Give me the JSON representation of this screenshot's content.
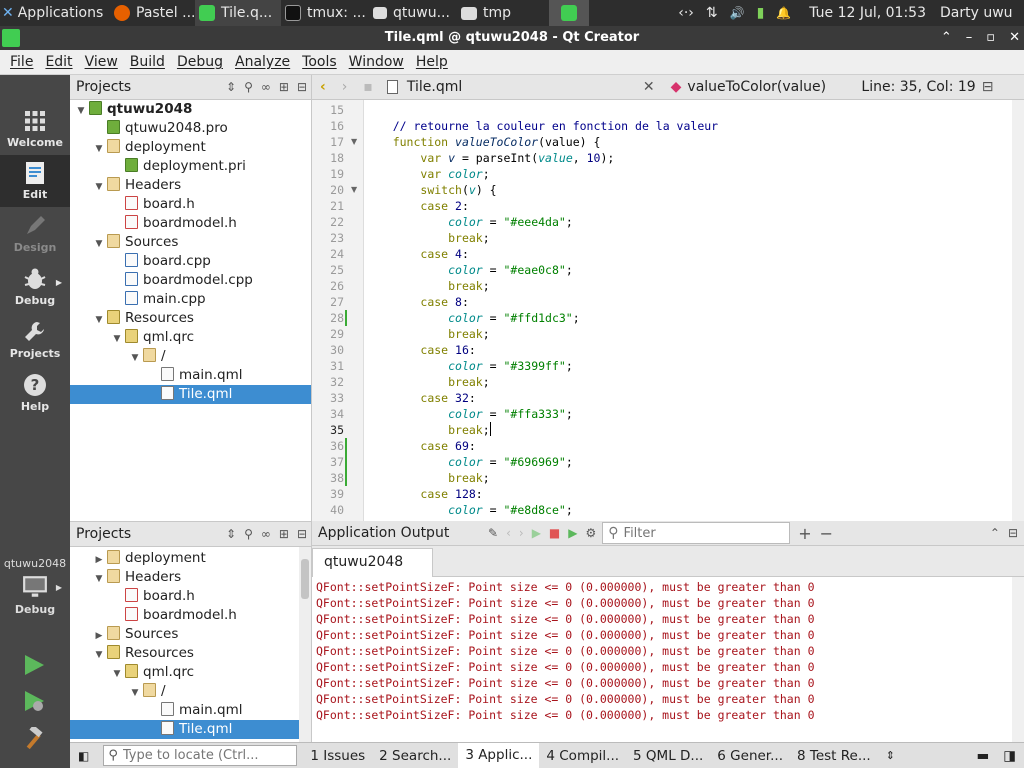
{
  "taskbar": {
    "applications": "Applications",
    "menu_glyph": "⋮",
    "items": [
      "Pastel ...",
      "Tile.q...",
      "tmux: ...",
      "qtuwu...",
      "tmp"
    ],
    "tray_glyphs": [
      "‹·›",
      "⇅",
      "🔊",
      "▮",
      "🔔"
    ],
    "clock": "Tue 12 Jul, 01:53",
    "user": "Darty uwu"
  },
  "window": {
    "title": "Tile.qml @ qtuwu2048 - Qt Creator",
    "controls": [
      "⌃",
      "–",
      "▫",
      "✕"
    ]
  },
  "menubar": [
    "File",
    "Edit",
    "View",
    "Build",
    "Debug",
    "Analyze",
    "Tools",
    "Window",
    "Help"
  ],
  "modes": [
    {
      "label": "Welcome"
    },
    {
      "label": "Edit"
    },
    {
      "label": "Design"
    },
    {
      "label": "Debug"
    },
    {
      "label": "Projects"
    },
    {
      "label": "Help"
    }
  ],
  "kit": {
    "project": "qtuwu2048",
    "mode": "Debug"
  },
  "projects_top": {
    "title": "Projects",
    "tree": [
      {
        "label": "qtuwu2048",
        "depth": 0,
        "arrow": "▼",
        "icon": "pro",
        "bold": true
      },
      {
        "label": "qtuwu2048.pro",
        "depth": 1,
        "arrow": "",
        "icon": "pro"
      },
      {
        "label": "deployment",
        "depth": 1,
        "arrow": "▼",
        "icon": "folder"
      },
      {
        "label": "deployment.pri",
        "depth": 2,
        "arrow": "",
        "icon": "pro"
      },
      {
        "label": "Headers",
        "depth": 1,
        "arrow": "▼",
        "icon": "folder"
      },
      {
        "label": "board.h",
        "depth": 2,
        "arrow": "",
        "icon": "h"
      },
      {
        "label": "boardmodel.h",
        "depth": 2,
        "arrow": "",
        "icon": "h"
      },
      {
        "label": "Sources",
        "depth": 1,
        "arrow": "▼",
        "icon": "folder"
      },
      {
        "label": "board.cpp",
        "depth": 2,
        "arrow": "",
        "icon": "cpp"
      },
      {
        "label": "boardmodel.cpp",
        "depth": 2,
        "arrow": "",
        "icon": "cpp"
      },
      {
        "label": "main.cpp",
        "depth": 2,
        "arrow": "",
        "icon": "cpp"
      },
      {
        "label": "Resources",
        "depth": 1,
        "arrow": "▼",
        "icon": "res"
      },
      {
        "label": "qml.qrc",
        "depth": 2,
        "arrow": "▼",
        "icon": "res"
      },
      {
        "label": "/",
        "depth": 3,
        "arrow": "▼",
        "icon": "folder"
      },
      {
        "label": "main.qml",
        "depth": 4,
        "arrow": "",
        "icon": "qml"
      },
      {
        "label": "Tile.qml",
        "depth": 4,
        "arrow": "",
        "icon": "qml",
        "selected": true
      }
    ]
  },
  "projects_bottom": {
    "title": "Projects",
    "tree": [
      {
        "label": "deployment",
        "depth": 1,
        "arrow": "▶",
        "icon": "folder"
      },
      {
        "label": "Headers",
        "depth": 1,
        "arrow": "▼",
        "icon": "folder"
      },
      {
        "label": "board.h",
        "depth": 2,
        "arrow": "",
        "icon": "h"
      },
      {
        "label": "boardmodel.h",
        "depth": 2,
        "arrow": "",
        "icon": "h"
      },
      {
        "label": "Sources",
        "depth": 1,
        "arrow": "▶",
        "icon": "folder"
      },
      {
        "label": "Resources",
        "depth": 1,
        "arrow": "▼",
        "icon": "res"
      },
      {
        "label": "qml.qrc",
        "depth": 2,
        "arrow": "▼",
        "icon": "res"
      },
      {
        "label": "/",
        "depth": 3,
        "arrow": "▼",
        "icon": "folder"
      },
      {
        "label": "main.qml",
        "depth": 4,
        "arrow": "",
        "icon": "qml"
      },
      {
        "label": "Tile.qml",
        "depth": 4,
        "arrow": "",
        "icon": "qml",
        "selected": true
      }
    ]
  },
  "editor": {
    "file": "Tile.qml",
    "symbol": "valueToColor(value)",
    "position": "Line: 35, Col: 19",
    "current_line": 35,
    "lines": [
      {
        "n": 15,
        "seg": [],
        "fold": false,
        "chg": false
      },
      {
        "n": 16,
        "seg": [
          [
            "    // retourne la couleur en fonction de la valeur",
            "cm"
          ]
        ],
        "fold": false,
        "chg": false
      },
      {
        "n": 17,
        "seg": [
          [
            "    function ",
            "kw"
          ],
          [
            "valueToColor",
            "it"
          ],
          [
            "(value) {",
            ""
          ]
        ],
        "fold": true,
        "chg": false
      },
      {
        "n": 18,
        "seg": [
          [
            "        ",
            ""
          ],
          [
            "var ",
            "kw"
          ],
          [
            "v",
            "it"
          ],
          [
            " = parseInt(",
            ""
          ],
          [
            "value",
            "vr"
          ],
          [
            ", ",
            ""
          ],
          [
            "10",
            "num"
          ],
          [
            ");",
            ""
          ]
        ],
        "fold": false,
        "chg": false
      },
      {
        "n": 19,
        "seg": [
          [
            "        ",
            ""
          ],
          [
            "var ",
            "kw"
          ],
          [
            "color",
            "vr"
          ],
          [
            ";",
            ""
          ]
        ],
        "fold": false,
        "chg": false
      },
      {
        "n": 20,
        "seg": [
          [
            "        ",
            ""
          ],
          [
            "switch",
            "kw"
          ],
          [
            "(",
            ""
          ],
          [
            "v",
            "vr"
          ],
          [
            ") {",
            ""
          ]
        ],
        "fold": true,
        "chg": false
      },
      {
        "n": 21,
        "seg": [
          [
            "        ",
            ""
          ],
          [
            "case ",
            "kw"
          ],
          [
            "2",
            "num"
          ],
          [
            ":",
            ""
          ]
        ],
        "fold": false,
        "chg": false
      },
      {
        "n": 22,
        "seg": [
          [
            "            ",
            ""
          ],
          [
            "color",
            "vr"
          ],
          [
            " = ",
            ""
          ],
          [
            "\"#eee4da\"",
            "str"
          ],
          [
            ";",
            ""
          ]
        ],
        "fold": false,
        "chg": false
      },
      {
        "n": 23,
        "seg": [
          [
            "            ",
            ""
          ],
          [
            "break",
            "kw"
          ],
          [
            ";",
            ""
          ]
        ],
        "fold": false,
        "chg": false
      },
      {
        "n": 24,
        "seg": [
          [
            "        ",
            ""
          ],
          [
            "case ",
            "kw"
          ],
          [
            "4",
            "num"
          ],
          [
            ":",
            ""
          ]
        ],
        "fold": false,
        "chg": false
      },
      {
        "n": 25,
        "seg": [
          [
            "            ",
            ""
          ],
          [
            "color",
            "vr"
          ],
          [
            " = ",
            ""
          ],
          [
            "\"#eae0c8\"",
            "str"
          ],
          [
            ";",
            ""
          ]
        ],
        "fold": false,
        "chg": false
      },
      {
        "n": 26,
        "seg": [
          [
            "            ",
            ""
          ],
          [
            "break",
            "kw"
          ],
          [
            ";",
            ""
          ]
        ],
        "fold": false,
        "chg": false
      },
      {
        "n": 27,
        "seg": [
          [
            "        ",
            ""
          ],
          [
            "case ",
            "kw"
          ],
          [
            "8",
            "num"
          ],
          [
            ":",
            ""
          ]
        ],
        "fold": false,
        "chg": false
      },
      {
        "n": 28,
        "seg": [
          [
            "            ",
            ""
          ],
          [
            "color",
            "vr"
          ],
          [
            " = ",
            ""
          ],
          [
            "\"#ffd1dc3\"",
            "str"
          ],
          [
            ";",
            ""
          ]
        ],
        "fold": false,
        "chg": true
      },
      {
        "n": 29,
        "seg": [
          [
            "            ",
            ""
          ],
          [
            "break",
            "kw"
          ],
          [
            ";",
            ""
          ]
        ],
        "fold": false,
        "chg": false
      },
      {
        "n": 30,
        "seg": [
          [
            "        ",
            ""
          ],
          [
            "case ",
            "kw"
          ],
          [
            "16",
            "num"
          ],
          [
            ":",
            ""
          ]
        ],
        "fold": false,
        "chg": false
      },
      {
        "n": 31,
        "seg": [
          [
            "            ",
            ""
          ],
          [
            "color",
            "vr"
          ],
          [
            " = ",
            ""
          ],
          [
            "\"#3399ff\"",
            "str"
          ],
          [
            ";",
            ""
          ]
        ],
        "fold": false,
        "chg": false
      },
      {
        "n": 32,
        "seg": [
          [
            "            ",
            ""
          ],
          [
            "break",
            "kw"
          ],
          [
            ";",
            ""
          ]
        ],
        "fold": false,
        "chg": false
      },
      {
        "n": 33,
        "seg": [
          [
            "        ",
            ""
          ],
          [
            "case ",
            "kw"
          ],
          [
            "32",
            "num"
          ],
          [
            ":",
            ""
          ]
        ],
        "fold": false,
        "chg": false
      },
      {
        "n": 34,
        "seg": [
          [
            "            ",
            ""
          ],
          [
            "color",
            "vr"
          ],
          [
            " = ",
            ""
          ],
          [
            "\"#ffa333\"",
            "str"
          ],
          [
            ";",
            ""
          ]
        ],
        "fold": false,
        "chg": false
      },
      {
        "n": 35,
        "seg": [
          [
            "            ",
            ""
          ],
          [
            "break",
            "kw"
          ],
          [
            ";",
            ""
          ]
        ],
        "fold": false,
        "chg": false
      },
      {
        "n": 36,
        "seg": [
          [
            "        ",
            ""
          ],
          [
            "case ",
            "kw"
          ],
          [
            "69",
            "num"
          ],
          [
            ":",
            ""
          ]
        ],
        "fold": false,
        "chg": true
      },
      {
        "n": 37,
        "seg": [
          [
            "            ",
            ""
          ],
          [
            "color",
            "vr"
          ],
          [
            " = ",
            ""
          ],
          [
            "\"#696969\"",
            "str"
          ],
          [
            ";",
            ""
          ]
        ],
        "fold": false,
        "chg": true
      },
      {
        "n": 38,
        "seg": [
          [
            "            ",
            ""
          ],
          [
            "break",
            "kw"
          ],
          [
            ";",
            ""
          ]
        ],
        "fold": false,
        "chg": true
      },
      {
        "n": 39,
        "seg": [
          [
            "        ",
            ""
          ],
          [
            "case ",
            "kw"
          ],
          [
            "128",
            "num"
          ],
          [
            ":",
            ""
          ]
        ],
        "fold": false,
        "chg": false
      },
      {
        "n": 40,
        "seg": [
          [
            "            ",
            ""
          ],
          [
            "color",
            "vr"
          ],
          [
            " = ",
            ""
          ],
          [
            "\"#e8d8ce\"",
            "str"
          ],
          [
            ";",
            ""
          ]
        ],
        "fold": false,
        "chg": false
      }
    ]
  },
  "output": {
    "title": "Application Output",
    "filter_placeholder": "Filter",
    "tab": "qtuwu2048",
    "lines": [
      "QFont::setPointSizeF: Point size <= 0 (0.000000), must be greater than 0",
      "QFont::setPointSizeF: Point size <= 0 (0.000000), must be greater than 0",
      "QFont::setPointSizeF: Point size <= 0 (0.000000), must be greater than 0",
      "QFont::setPointSizeF: Point size <= 0 (0.000000), must be greater than 0",
      "QFont::setPointSizeF: Point size <= 0 (0.000000), must be greater than 0",
      "QFont::setPointSizeF: Point size <= 0 (0.000000), must be greater than 0",
      "QFont::setPointSizeF: Point size <= 0 (0.000000), must be greater than 0",
      "QFont::setPointSizeF: Point size <= 0 (0.000000), must be greater than 0",
      "QFont::setPointSizeF: Point size <= 0 (0.000000), must be greater than 0"
    ]
  },
  "statusbar": {
    "locate_placeholder": "Type to locate (Ctrl...",
    "panes": [
      "1  Issues",
      "2  Search...",
      "3  Applic...",
      "4  Compil...",
      "5  QML D...",
      "6  Gener...",
      "8  Test Re..."
    ],
    "active_pane": 2
  }
}
